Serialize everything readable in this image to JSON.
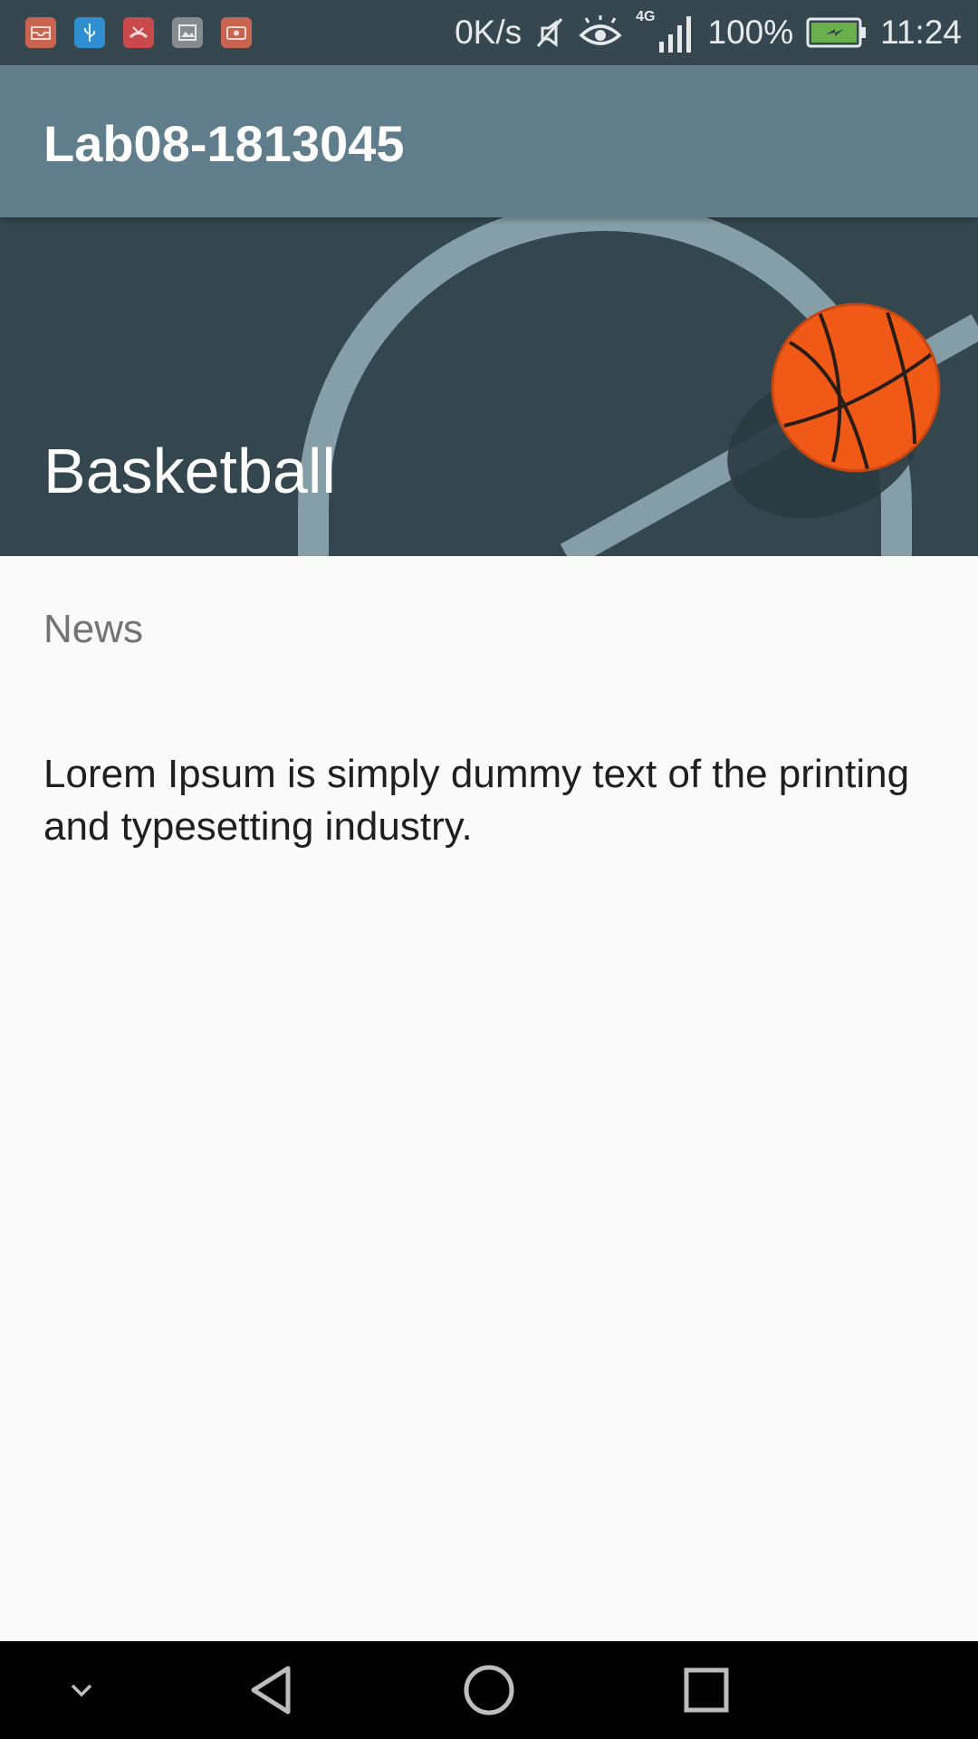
{
  "status_bar": {
    "notification_icons": [
      "mail-icon",
      "usb-icon",
      "missed-call-icon",
      "image-icon",
      "screen-record-icon"
    ],
    "network_speed": "0K/s",
    "mute_icon": "mute-icon",
    "eye_icon": "eye-comfort-icon",
    "network_type": "4G",
    "signal_icon": "signal-icon",
    "battery_percent": "100%",
    "battery_icon": "battery-charging-icon",
    "time": "11:24"
  },
  "app_bar": {
    "title": "Lab08-1813045"
  },
  "banner": {
    "sport_title": "Basketball",
    "image": "basketball-court-image"
  },
  "content": {
    "section_label": "News",
    "body": "Lorem Ipsum is simply dummy text of the printing and typesetting industry."
  },
  "nav_bar": {
    "buttons": [
      "chevron-down-icon",
      "back-icon",
      "home-icon",
      "recents-icon"
    ]
  },
  "colors": {
    "status_bar": "#37474f",
    "app_bar": "#607d8b",
    "banner": "#34464e",
    "ball": "#f05a16",
    "court_line": "#8ea7b1"
  }
}
